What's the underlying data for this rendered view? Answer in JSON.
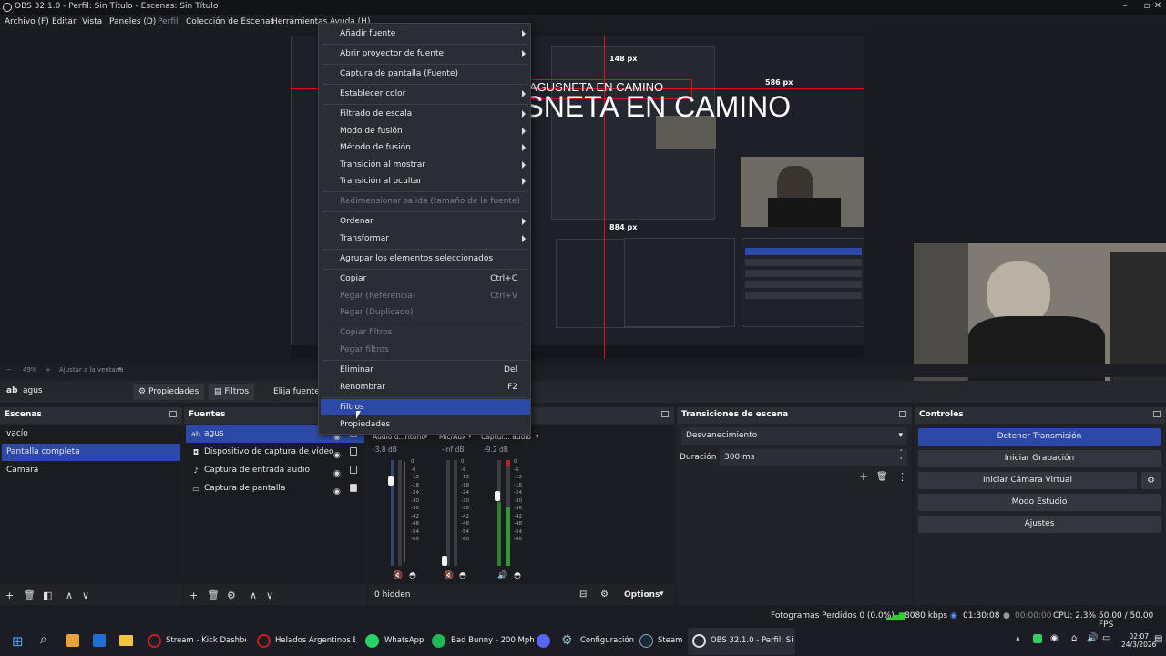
{
  "window": {
    "title": "OBS 32.1.0 - Perfil: Sin Título - Escenas: Sin Título"
  },
  "menubar": [
    "Archivo (F)",
    "Editar",
    "Vista",
    "Paneles (D)",
    "Perfil",
    "Colección de Escenas",
    "Herramientas",
    "Ayuda (H)"
  ],
  "preview": {
    "overlay_text": "AGUSNETA EN CAMINO",
    "overlay_text_small": "AGUSNETA EN CAMINO",
    "measure_top": "148 px",
    "measure_right": "586 px",
    "measure_bottom": "884 px",
    "zoom": "49%",
    "zoom_fit": "Ajustar a la ventana"
  },
  "toolbar": {
    "source_name": "agus",
    "properties": "Propiedades",
    "filters": "Filtros",
    "choose_source": "Elija fuente"
  },
  "context_menu": [
    {
      "label": "Añadir fuente",
      "submenu": true
    },
    {
      "label": "Abrir proyector de fuente",
      "submenu": true
    },
    {
      "label": "Captura de pantalla (Fuente)"
    },
    {
      "label": "Establecer color",
      "submenu": true
    },
    {
      "label": "Filtrado de escala",
      "submenu": true
    },
    {
      "label": "Modo de fusión",
      "submenu": true
    },
    {
      "label": "Método de fusión",
      "submenu": true
    },
    {
      "label": "Transición al mostrar",
      "submenu": true
    },
    {
      "label": "Transición al ocultar",
      "submenu": true
    },
    {
      "label": "Redimensionar salida (tamaño de la fuente)",
      "disabled": true
    },
    {
      "label": "Ordenar",
      "submenu": true
    },
    {
      "label": "Transformar",
      "submenu": true
    },
    {
      "label": "Agrupar los elementos seleccionados"
    },
    {
      "label": "Copiar",
      "shortcut": "Ctrl+C"
    },
    {
      "label": "Pegar (Referencia)",
      "shortcut": "Ctrl+V",
      "disabled": true
    },
    {
      "label": "Pegar (Duplicado)",
      "disabled": true
    },
    {
      "label": "Copiar filtros",
      "disabled": true
    },
    {
      "label": "Pegar filtros",
      "disabled": true
    },
    {
      "label": "Eliminar",
      "shortcut": "Del"
    },
    {
      "label": "Renombrar",
      "shortcut": "F2"
    },
    {
      "label": "Filtros",
      "highlighted": true
    },
    {
      "label": "Propiedades"
    }
  ],
  "scenes": {
    "title": "Escenas",
    "items": [
      "vacío",
      "Pantalla completa",
      "Camara"
    ],
    "selected": "Pantalla completa"
  },
  "sources": {
    "title": "Fuentes",
    "items": [
      {
        "name": "agus",
        "icon": "text-icon",
        "glyph": "ab"
      },
      {
        "name": "Dispositivo de captura de vídeo",
        "icon": "camera-icon",
        "glyph": "◘"
      },
      {
        "name": "Captura de entrada audio",
        "icon": "microphone-icon",
        "glyph": "♪"
      },
      {
        "name": "Captura de pantalla",
        "icon": "monitor-icon",
        "glyph": "▭"
      }
    ]
  },
  "mixer": {
    "channels": [
      {
        "name": "Audio d...ritorio",
        "db": "-3.8 dB",
        "level": 0.86
      },
      {
        "name": "Mic/Aux",
        "db": "-inf dB",
        "level": 0.02
      },
      {
        "name": "Captur... audio",
        "db": "-9.2 dB",
        "level": 0.71
      }
    ],
    "scale": [
      "0",
      "-6",
      "-12",
      "-18",
      "-24",
      "-30",
      "-36",
      "-42",
      "-48",
      "-54",
      "-60"
    ],
    "hidden": "0 hidden",
    "options": "Options"
  },
  "transitions": {
    "title": "Transiciones de escena",
    "selected": "Desvanecimiento",
    "duration_label": "Duración",
    "duration_value": "300 ms"
  },
  "controls": {
    "title": "Controles",
    "buttons": [
      "Detener Transmisión",
      "Iniciar Grabación",
      "Iniciar Cámara Virtual",
      "Modo Estudio",
      "Ajustes"
    ]
  },
  "statusbar": {
    "dropped": "Fotogramas Perdidos 0 (0.0%)",
    "bitrate": "8080 kbps",
    "stream_time": "01:30:08",
    "rec_time": "00:00:00",
    "cpu": "CPU: 2.3%",
    "fps": "50.00 / 50.00 FPS"
  },
  "taskbar": {
    "apps": [
      "Stream - Kick Dashboard",
      "Helados Argentinos Bra",
      "WhatsApp",
      "Bad Bunny - 200 Mph",
      "Configuración",
      "Steam",
      "OBS 32.1.0 - Perfil: Sin Tí"
    ],
    "time": "02:07",
    "date": "24/3/2026"
  },
  "colors": {
    "accent": "#2d49a8",
    "red_guides": "#e0101a",
    "panel": "#222329"
  }
}
